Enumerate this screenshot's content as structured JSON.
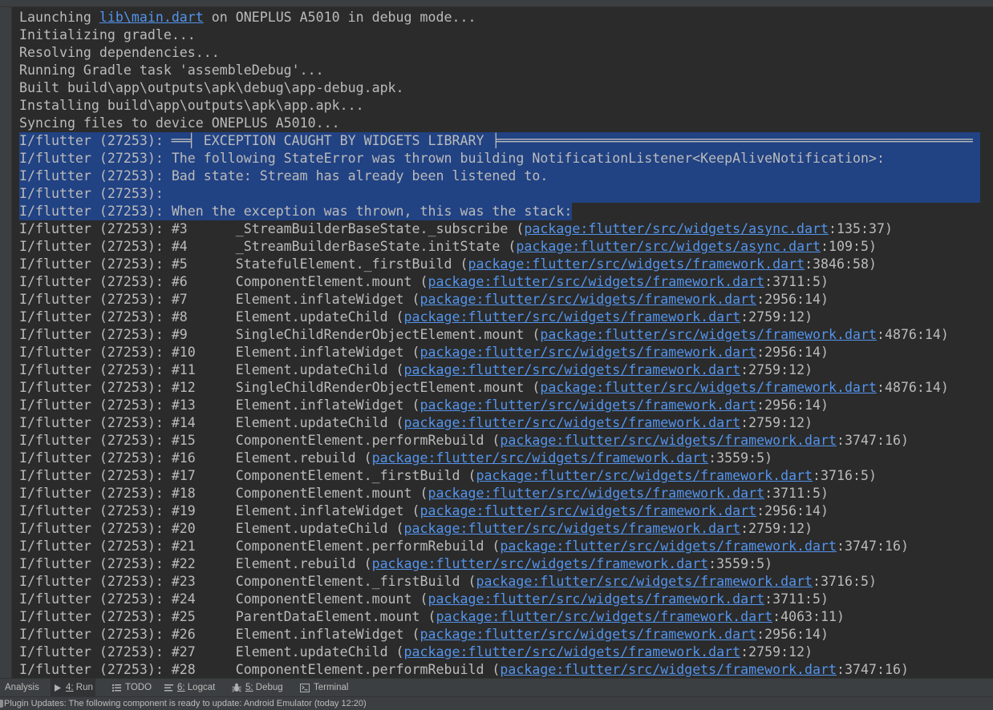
{
  "theme": {
    "background": "#2b2b2b",
    "panel": "#3c3f41",
    "text": "#bbbbbb",
    "link": "#5394ec",
    "selection": "#214283"
  },
  "console": {
    "lines": [
      {
        "segments": [
          {
            "text": "Launching "
          },
          {
            "text": "lib\\main.dart",
            "link": true
          },
          {
            "text": " on ONEPLUS A5010 in debug mode..."
          }
        ]
      },
      {
        "segments": [
          {
            "text": "Initializing gradle..."
          }
        ]
      },
      {
        "segments": [
          {
            "text": "Resolving dependencies..."
          }
        ]
      },
      {
        "segments": [
          {
            "text": "Running Gradle task 'assembleDebug'..."
          }
        ]
      },
      {
        "segments": [
          {
            "text": "Built build\\app\\outputs\\apk\\debug\\app-debug.apk."
          }
        ]
      },
      {
        "segments": [
          {
            "text": "Installing build\\app\\outputs\\apk\\app.apk..."
          }
        ]
      },
      {
        "segments": [
          {
            "text": "Syncing files to device ONEPLUS A5010..."
          }
        ]
      },
      {
        "selected": true,
        "segments": [
          {
            "text": "I/flutter (27253): ══╡ EXCEPTION CAUGHT BY WIDGETS LIBRARY ╞═══════════════════════════════════════════════════════════"
          }
        ]
      },
      {
        "selected": true,
        "segments": [
          {
            "text": "I/flutter (27253): The following StateError was thrown building NotificationListener<KeepAliveNotification>:"
          }
        ]
      },
      {
        "selected": true,
        "segments": [
          {
            "text": "I/flutter (27253): Bad state: Stream has already been listened to."
          }
        ]
      },
      {
        "selected": true,
        "segments": [
          {
            "text": "I/flutter (27253):"
          }
        ]
      },
      {
        "selected": true,
        "segments": [
          {
            "text": "I/flutter (27253): When the exception was thrown, this was the stack:"
          }
        ]
      },
      {
        "segments": [
          {
            "text": "I/flutter (27253): #3      _StreamBuilderBaseState._subscribe ("
          },
          {
            "text": "package:flutter/src/widgets/async.dart",
            "link": true
          },
          {
            "text": ":135:37)"
          }
        ]
      },
      {
        "segments": [
          {
            "text": "I/flutter (27253): #4      _StreamBuilderBaseState.initState ("
          },
          {
            "text": "package:flutter/src/widgets/async.dart",
            "link": true
          },
          {
            "text": ":109:5)"
          }
        ]
      },
      {
        "segments": [
          {
            "text": "I/flutter (27253): #5      StatefulElement._firstBuild ("
          },
          {
            "text": "package:flutter/src/widgets/framework.dart",
            "link": true
          },
          {
            "text": ":3846:58)"
          }
        ]
      },
      {
        "segments": [
          {
            "text": "I/flutter (27253): #6      ComponentElement.mount ("
          },
          {
            "text": "package:flutter/src/widgets/framework.dart",
            "link": true
          },
          {
            "text": ":3711:5)"
          }
        ]
      },
      {
        "segments": [
          {
            "text": "I/flutter (27253): #7      Element.inflateWidget ("
          },
          {
            "text": "package:flutter/src/widgets/framework.dart",
            "link": true
          },
          {
            "text": ":2956:14)"
          }
        ]
      },
      {
        "segments": [
          {
            "text": "I/flutter (27253): #8      Element.updateChild ("
          },
          {
            "text": "package:flutter/src/widgets/framework.dart",
            "link": true
          },
          {
            "text": ":2759:12)"
          }
        ]
      },
      {
        "segments": [
          {
            "text": "I/flutter (27253): #9      SingleChildRenderObjectElement.mount ("
          },
          {
            "text": "package:flutter/src/widgets/framework.dart",
            "link": true
          },
          {
            "text": ":4876:14)"
          }
        ]
      },
      {
        "segments": [
          {
            "text": "I/flutter (27253): #10     Element.inflateWidget ("
          },
          {
            "text": "package:flutter/src/widgets/framework.dart",
            "link": true
          },
          {
            "text": ":2956:14)"
          }
        ]
      },
      {
        "segments": [
          {
            "text": "I/flutter (27253): #11     Element.updateChild ("
          },
          {
            "text": "package:flutter/src/widgets/framework.dart",
            "link": true
          },
          {
            "text": ":2759:12)"
          }
        ]
      },
      {
        "segments": [
          {
            "text": "I/flutter (27253): #12     SingleChildRenderObjectElement.mount ("
          },
          {
            "text": "package:flutter/src/widgets/framework.dart",
            "link": true
          },
          {
            "text": ":4876:14)"
          }
        ]
      },
      {
        "segments": [
          {
            "text": "I/flutter (27253): #13     Element.inflateWidget ("
          },
          {
            "text": "package:flutter/src/widgets/framework.dart",
            "link": true
          },
          {
            "text": ":2956:14)"
          }
        ]
      },
      {
        "segments": [
          {
            "text": "I/flutter (27253): #14     Element.updateChild ("
          },
          {
            "text": "package:flutter/src/widgets/framework.dart",
            "link": true
          },
          {
            "text": ":2759:12)"
          }
        ]
      },
      {
        "segments": [
          {
            "text": "I/flutter (27253): #15     ComponentElement.performRebuild ("
          },
          {
            "text": "package:flutter/src/widgets/framework.dart",
            "link": true
          },
          {
            "text": ":3747:16)"
          }
        ]
      },
      {
        "segments": [
          {
            "text": "I/flutter (27253): #16     Element.rebuild ("
          },
          {
            "text": "package:flutter/src/widgets/framework.dart",
            "link": true
          },
          {
            "text": ":3559:5)"
          }
        ]
      },
      {
        "segments": [
          {
            "text": "I/flutter (27253): #17     ComponentElement._firstBuild ("
          },
          {
            "text": "package:flutter/src/widgets/framework.dart",
            "link": true
          },
          {
            "text": ":3716:5)"
          }
        ]
      },
      {
        "segments": [
          {
            "text": "I/flutter (27253): #18     ComponentElement.mount ("
          },
          {
            "text": "package:flutter/src/widgets/framework.dart",
            "link": true
          },
          {
            "text": ":3711:5)"
          }
        ]
      },
      {
        "segments": [
          {
            "text": "I/flutter (27253): #19     Element.inflateWidget ("
          },
          {
            "text": "package:flutter/src/widgets/framework.dart",
            "link": true
          },
          {
            "text": ":2956:14)"
          }
        ]
      },
      {
        "segments": [
          {
            "text": "I/flutter (27253): #20     Element.updateChild ("
          },
          {
            "text": "package:flutter/src/widgets/framework.dart",
            "link": true
          },
          {
            "text": ":2759:12)"
          }
        ]
      },
      {
        "segments": [
          {
            "text": "I/flutter (27253): #21     ComponentElement.performRebuild ("
          },
          {
            "text": "package:flutter/src/widgets/framework.dart",
            "link": true
          },
          {
            "text": ":3747:16)"
          }
        ]
      },
      {
        "segments": [
          {
            "text": "I/flutter (27253): #22     Element.rebuild ("
          },
          {
            "text": "package:flutter/src/widgets/framework.dart",
            "link": true
          },
          {
            "text": ":3559:5)"
          }
        ]
      },
      {
        "segments": [
          {
            "text": "I/flutter (27253): #23     ComponentElement._firstBuild ("
          },
          {
            "text": "package:flutter/src/widgets/framework.dart",
            "link": true
          },
          {
            "text": ":3716:5)"
          }
        ]
      },
      {
        "segments": [
          {
            "text": "I/flutter (27253): #24     ComponentElement.mount ("
          },
          {
            "text": "package:flutter/src/widgets/framework.dart",
            "link": true
          },
          {
            "text": ":3711:5)"
          }
        ]
      },
      {
        "segments": [
          {
            "text": "I/flutter (27253): #25     ParentDataElement.mount ("
          },
          {
            "text": "package:flutter/src/widgets/framework.dart",
            "link": true
          },
          {
            "text": ":4063:11)"
          }
        ]
      },
      {
        "segments": [
          {
            "text": "I/flutter (27253): #26     Element.inflateWidget ("
          },
          {
            "text": "package:flutter/src/widgets/framework.dart",
            "link": true
          },
          {
            "text": ":2956:14)"
          }
        ]
      },
      {
        "segments": [
          {
            "text": "I/flutter (27253): #27     Element.updateChild ("
          },
          {
            "text": "package:flutter/src/widgets/framework.dart",
            "link": true
          },
          {
            "text": ":2759:12)"
          }
        ]
      },
      {
        "segments": [
          {
            "text": "I/flutter (27253): #28     ComponentElement.performRebuild ("
          },
          {
            "text": "package:flutter/src/widgets/framework.dart",
            "link": true
          },
          {
            "text": ":3747:16)"
          }
        ]
      }
    ]
  },
  "tool_windows": [
    {
      "label": "Analysis"
    },
    {
      "label": "4: Run",
      "icon": "run-icon",
      "active": true
    },
    {
      "label": "TODO",
      "icon": "todo-icon"
    },
    {
      "label": "6: Logcat",
      "icon": "logcat-icon"
    },
    {
      "label": "5: Debug",
      "icon": "debug-icon"
    },
    {
      "label": "Terminal",
      "icon": "terminal-icon"
    }
  ],
  "status_bar": {
    "icon": "notification-icon",
    "message": "Plugin Updates: The following component is ready to update: Android Emulator (today 12:20)"
  }
}
